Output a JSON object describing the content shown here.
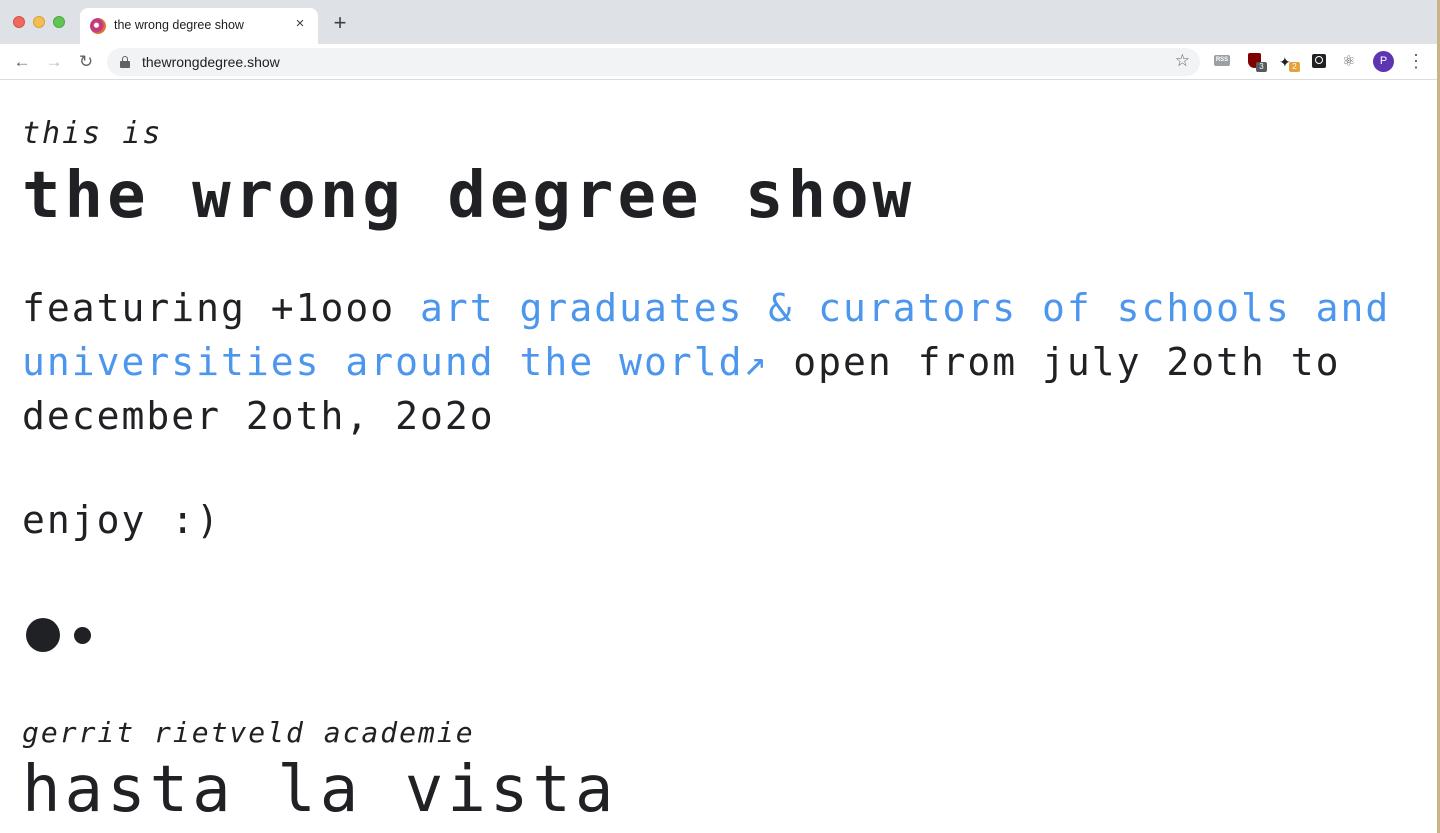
{
  "browser": {
    "tab": {
      "title": "the wrong degree show",
      "close_icon": "×"
    },
    "new_tab_icon": "+",
    "address_bar": {
      "url": "thewrongdegree.show"
    },
    "extensions": [
      {
        "name": "rss-extension-icon"
      },
      {
        "name": "ublock-icon",
        "badge": "3",
        "badge_color": "#555b61"
      },
      {
        "name": "ninja-extension-icon",
        "badge": "2",
        "badge_color": "#e6a23c"
      },
      {
        "name": "lens-extension-icon"
      },
      {
        "name": "extensions-puzzle-icon"
      }
    ],
    "profile_initial": "P",
    "profile_color": "#5e35b1"
  },
  "page": {
    "kicker": "this is",
    "title": "the wrong degree show",
    "intro": {
      "before": "featuring +1ooo ",
      "link": "art graduates & curators of schools and universities around the world↗",
      "after": " open from july 2oth to december 2oth, 2o2o"
    },
    "enjoy": "enjoy :)",
    "featured": {
      "school": "gerrit rietveld academie",
      "title": "hasta la vista"
    },
    "colors": {
      "text": "#202124",
      "link": "#4c96ee"
    }
  }
}
